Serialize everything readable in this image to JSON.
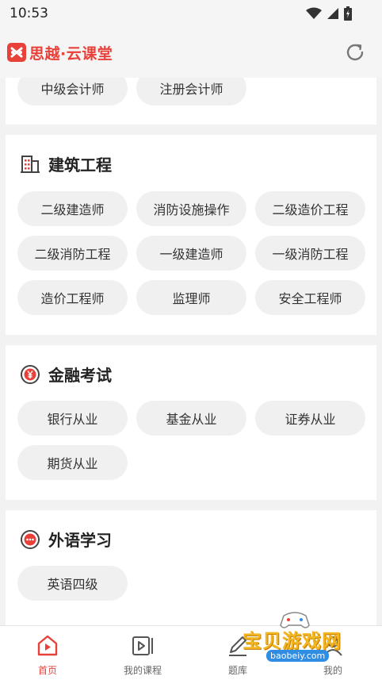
{
  "status_bar": {
    "time": "10:53"
  },
  "header": {
    "app_name": "思越·云课堂"
  },
  "sections": [
    {
      "id": "accounting",
      "title": "",
      "chips": [
        "中级会计师",
        "注册会计师"
      ]
    },
    {
      "id": "construction",
      "title": "建筑工程",
      "chips": [
        "二级建造师",
        "消防设施操作",
        "二级造价工程",
        "二级消防工程",
        "一级建造师",
        "一级消防工程",
        "造价工程师",
        "监理师",
        "安全工程师"
      ]
    },
    {
      "id": "finance",
      "title": "金融考试",
      "chips": [
        "银行从业",
        "基金从业",
        "证券从业",
        "期货从业"
      ]
    },
    {
      "id": "language",
      "title": "外语学习",
      "chips": [
        "英语四级"
      ]
    }
  ],
  "tabbar": {
    "items": [
      {
        "label": "首页",
        "active": true
      },
      {
        "label": "我的课程",
        "active": false
      },
      {
        "label": "题库",
        "active": false
      },
      {
        "label": "我的",
        "active": false
      }
    ]
  },
  "watermark": {
    "text": "宝贝游戏网",
    "url": "baobeiy.com"
  },
  "colors": {
    "accent": "#e8413a",
    "chip_bg": "#f0f0f0",
    "page_bg": "#f2f2f2"
  }
}
